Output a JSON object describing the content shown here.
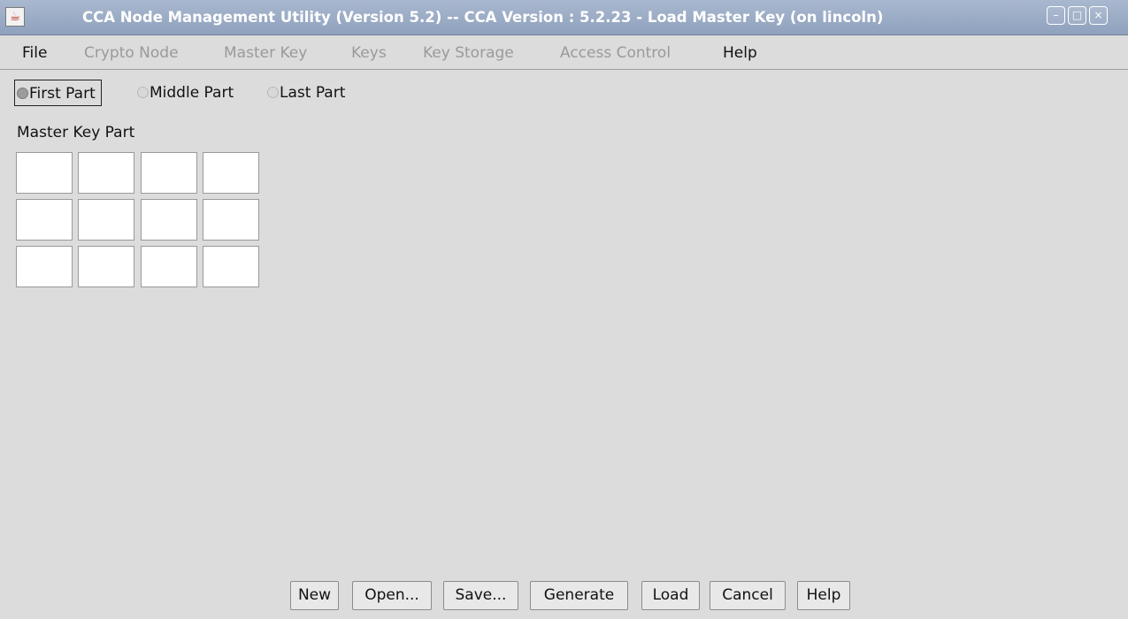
{
  "window": {
    "title": "CCA Node Management Utility (Version 5.2) -- CCA Version : 5.2.23  - Load Master Key (on lincoln)",
    "app_icon": "java-icon",
    "controls": {
      "minimize": "–",
      "maximize": "□",
      "close": "×"
    }
  },
  "menu": {
    "items": [
      {
        "label": "File",
        "enabled": true
      },
      {
        "label": "Crypto Node",
        "enabled": false
      },
      {
        "label": "Master Key",
        "enabled": false
      },
      {
        "label": "Keys",
        "enabled": false
      },
      {
        "label": "Key Storage",
        "enabled": false
      },
      {
        "label": "Access Control",
        "enabled": false
      },
      {
        "label": "Help",
        "enabled": true
      }
    ]
  },
  "part_selector": {
    "options": [
      {
        "label": "First Part",
        "checked": true
      },
      {
        "label": "Middle Part",
        "checked": false
      },
      {
        "label": "Last Part",
        "checked": false
      }
    ]
  },
  "master_key": {
    "label": "Master Key Part",
    "rows": [
      [
        "",
        "",
        "",
        ""
      ],
      [
        "",
        "",
        "",
        ""
      ],
      [
        "",
        "",
        "",
        ""
      ]
    ]
  },
  "buttons": {
    "new": "New",
    "open": "Open...",
    "save": "Save...",
    "generate": "Generate",
    "load": "Load",
    "cancel": "Cancel",
    "help": "Help"
  },
  "colors": {
    "titlebar": "#8fa1bd",
    "background": "#dcdcdc",
    "disabled_text": "#9a9a9a"
  }
}
